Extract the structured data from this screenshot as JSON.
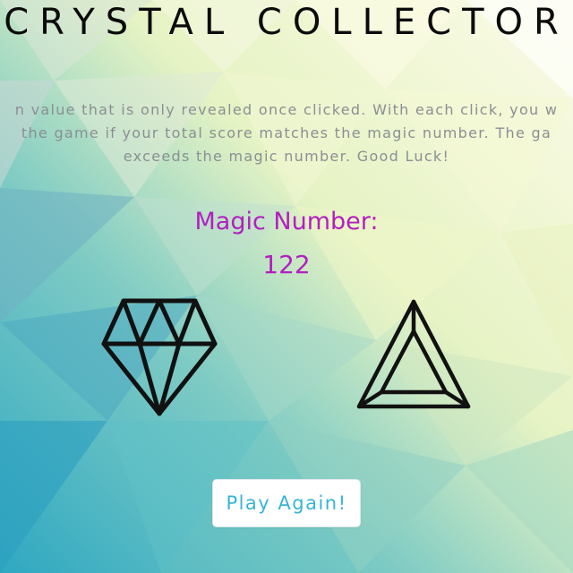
{
  "game": {
    "title": "CRYSTAL COLLECTOR",
    "instructions": [
      "n value that is only revealed once clicked. With each click, you w",
      "the game if your total score matches the magic number. The ga",
      "exceeds the magic number. Good Luck!"
    ],
    "magic_label": "Magic Number:",
    "magic_value": 122,
    "play_again_label": "Play Again!"
  },
  "crystals": [
    {
      "name": "diamond",
      "icon": "diamond-crystal-icon"
    },
    {
      "name": "triangle",
      "icon": "triangle-crystal-icon"
    }
  ],
  "colors": {
    "title": "#0b0b0b",
    "instructions": "#8b8f94",
    "magic": "#b21fc0",
    "button_text": "#37b4d6",
    "button_bg": "#ffffff",
    "crystal_stroke": "#111111"
  }
}
